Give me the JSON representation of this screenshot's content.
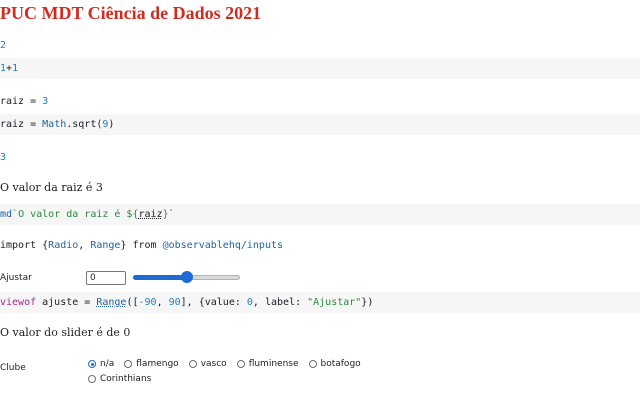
{
  "title": "PUC MDT Ciência de Dados 2021",
  "cells": [
    {
      "output": "2",
      "code_num1": "1",
      "code_op": "+",
      "code_num2": "1"
    },
    {
      "output_var": "raiz",
      "output_eq": " = ",
      "output_val": "3",
      "code_var": "raiz",
      "code_eq": " = ",
      "code_fn": "Math",
      "code_method": ".sqrt(",
      "code_arg": "9",
      "code_close": ")"
    },
    {
      "output": "3"
    },
    {
      "prose": "O valor da raiz é 3",
      "code_tag": "md",
      "code_text": "`O valor da raiz é ${",
      "code_var": "raiz",
      "code_end": "}`"
    },
    {
      "import_kw": "import",
      "import_names_open": " {",
      "import_radio": "Radio",
      "import_comma": ", ",
      "import_range": "Range",
      "import_names_close": "} ",
      "import_from": "from",
      "import_module": " @observablehq/inputs"
    },
    {
      "slider_label": "Ajustar",
      "slider_value": "0",
      "slider_fraction": 0.5,
      "code_kw": "viewof",
      "code_var": " ajuste = ",
      "code_fn": "Range",
      "code_args1": "([",
      "code_min": "-90",
      "code_sep": ", ",
      "code_max": "90",
      "code_args2": "], {value: ",
      "code_val": "0",
      "code_args3": ", label: ",
      "code_str": "\"Ajustar\"",
      "code_end": "})"
    },
    {
      "prose": "O valor do slider é de 0"
    },
    {
      "radio_label": "Clube",
      "options": [
        "n/a",
        "flamengo",
        "vasco",
        "fluminense",
        "botafogo",
        "Corinthians"
      ],
      "selected": "n/a"
    }
  ]
}
